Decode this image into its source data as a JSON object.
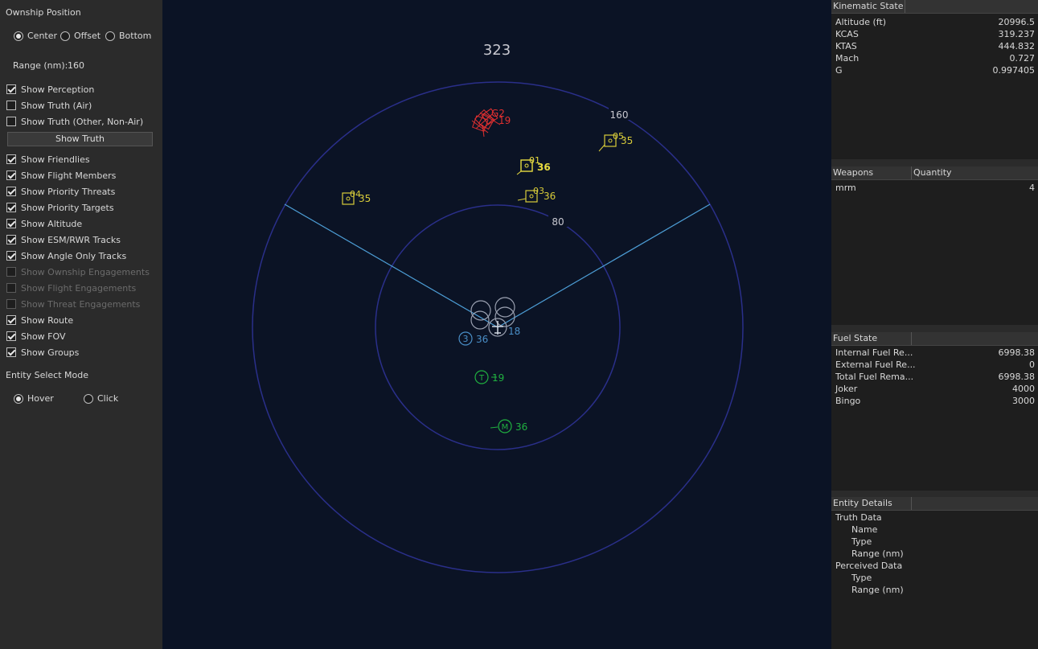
{
  "left_panel": {
    "ownship_position_title": "Ownship Position",
    "position_options": [
      "Center",
      "Offset",
      "Bottom"
    ],
    "position_selected": "Center",
    "range_label": "Range (nm):",
    "range_value": "160",
    "show_truth_button": "Show Truth",
    "checkboxes": [
      {
        "label": "Show Perception",
        "checked": true,
        "enabled": true
      },
      {
        "label": "Show Truth (Air)",
        "checked": false,
        "enabled": true
      },
      {
        "label": "Show Truth (Other, Non-Air)",
        "checked": false,
        "enabled": true
      },
      {
        "label": "Show Friendlies",
        "checked": true,
        "enabled": true
      },
      {
        "label": "Show Flight Members",
        "checked": true,
        "enabled": true
      },
      {
        "label": "Show Priority Threats",
        "checked": true,
        "enabled": true
      },
      {
        "label": "Show Priority Targets",
        "checked": true,
        "enabled": true
      },
      {
        "label": "Show Altitude",
        "checked": true,
        "enabled": true
      },
      {
        "label": "Show ESM/RWR Tracks",
        "checked": true,
        "enabled": true
      },
      {
        "label": "Show Angle Only Tracks",
        "checked": true,
        "enabled": true
      },
      {
        "label": "Show Ownship Engagements",
        "checked": false,
        "enabled": false
      },
      {
        "label": "Show Flight Engagements",
        "checked": false,
        "enabled": false
      },
      {
        "label": "Show Threat Engagements",
        "checked": false,
        "enabled": false
      },
      {
        "label": "Show Route",
        "checked": true,
        "enabled": true
      },
      {
        "label": "Show FOV",
        "checked": true,
        "enabled": true
      },
      {
        "label": "Show Groups",
        "checked": true,
        "enabled": true
      }
    ],
    "entity_select_title": "Entity Select Mode",
    "select_options": [
      "Hover",
      "Click"
    ],
    "select_selected": "Hover"
  },
  "scope": {
    "heading": "323",
    "ring_labels": [
      "160",
      "80"
    ],
    "colors": {
      "background": "#0b1325",
      "ring": "#2a2f8a",
      "fov": "#4d9ed6",
      "threat": "#e03030",
      "track": "#d8cc3a",
      "friendly": "#4a8fc8",
      "nav": "#20b040"
    },
    "tracks": [
      {
        "id": "01",
        "alt": "36"
      },
      {
        "id": "03",
        "alt": "36"
      },
      {
        "id": "04",
        "alt": "35"
      },
      {
        "id": "05",
        "alt": "35"
      }
    ],
    "threat_label": "G2",
    "threat_alt": "19",
    "friendly_alt_1": "36",
    "friendly_alt_2": "18",
    "friendly_id": "3",
    "waypoint_t": "T",
    "waypoint_t_alt": "19",
    "waypoint_m": "M",
    "waypoint_m_alt": "36"
  },
  "kinematic": {
    "title": "Kinematic State",
    "rows": [
      {
        "k": "Altitude (ft)",
        "v": "20996.5"
      },
      {
        "k": "KCAS",
        "v": "319.237"
      },
      {
        "k": "KTAS",
        "v": "444.832"
      },
      {
        "k": "Mach",
        "v": "0.727"
      },
      {
        "k": "G",
        "v": "0.997405"
      }
    ]
  },
  "weapons": {
    "col1": "Weapons",
    "col2": "Quantity",
    "rows": [
      {
        "k": "mrm",
        "v": "4"
      }
    ]
  },
  "fuel": {
    "title": "Fuel State",
    "rows": [
      {
        "k": "Internal Fuel Re...",
        "v": "6998.38"
      },
      {
        "k": "External Fuel Re...",
        "v": "0"
      },
      {
        "k": "Total Fuel Rema...",
        "v": "6998.38"
      },
      {
        "k": "Joker",
        "v": "4000"
      },
      {
        "k": "Bingo",
        "v": "3000"
      }
    ]
  },
  "entity": {
    "title": "Entity Details",
    "truth_title": "Truth Data",
    "truth_items": [
      "Name",
      "Type",
      "Range (nm)"
    ],
    "perceived_title": "Perceived Data",
    "perceived_items": [
      "Type",
      "Range (nm)"
    ]
  }
}
